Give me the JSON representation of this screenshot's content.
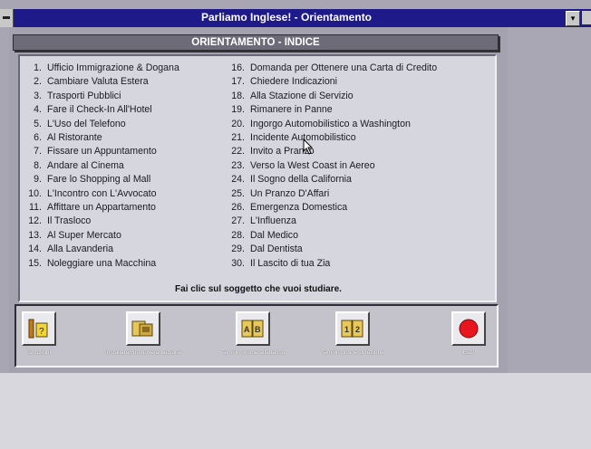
{
  "window": {
    "title": "Parliamo Inglese! - Orientamento",
    "minimize_glyph": "▾"
  },
  "header": {
    "title": "ORIENTAMENTO - INDICE"
  },
  "topics_left": [
    {
      "num": "1.",
      "label": "Ufficio Immigrazione & Dogana"
    },
    {
      "num": "2.",
      "label": "Cambiare Valuta Estera"
    },
    {
      "num": "3.",
      "label": "Trasporti Pubblici"
    },
    {
      "num": "4.",
      "label": "Fare il Check-In All'Hotel"
    },
    {
      "num": "5.",
      "label": "L'Uso del Telefono"
    },
    {
      "num": "6.",
      "label": "Al Ristorante"
    },
    {
      "num": "7.",
      "label": "Fissare un Appuntamento"
    },
    {
      "num": "8.",
      "label": "Andare al Cinema"
    },
    {
      "num": "9.",
      "label": "Fare lo Shopping al Mall"
    },
    {
      "num": "10.",
      "label": "L'Incontro con L'Avvocato"
    },
    {
      "num": "11.",
      "label": "Affittare un Appartamento"
    },
    {
      "num": "12.",
      "label": "Il Trasloco"
    },
    {
      "num": "13.",
      "label": "Al Super Mercato"
    },
    {
      "num": "14.",
      "label": "Alla Lavanderia"
    },
    {
      "num": "15.",
      "label": "Noleggiare una Macchina"
    }
  ],
  "topics_right": [
    {
      "num": "16.",
      "label": "Domanda per Ottenere una Carta di Credito"
    },
    {
      "num": "17.",
      "label": "Chiedere Indicazioni"
    },
    {
      "num": "18.",
      "label": "Alla Stazione di Servizio"
    },
    {
      "num": "19.",
      "label": "Rimanere in Panne"
    },
    {
      "num": "20.",
      "label": "Ingorgo Automobilistico a Washington"
    },
    {
      "num": "21.",
      "label": "Incidente Automobilistico"
    },
    {
      "num": "22.",
      "label": "Invito a Pranzo"
    },
    {
      "num": "23.",
      "label": "Verso la West Coast in Aereo"
    },
    {
      "num": "24.",
      "label": "Il Sogno della California"
    },
    {
      "num": "25.",
      "label": "Un Pranzo D'Affari"
    },
    {
      "num": "26.",
      "label": "Emergenza Domestica"
    },
    {
      "num": "27.",
      "label": "L'Influenza"
    },
    {
      "num": "28.",
      "label": "Dal Medico"
    },
    {
      "num": "29.",
      "label": "Dal Dentista"
    },
    {
      "num": "30.",
      "label": "Il Lascito di tua Zia"
    }
  ],
  "hint": "Fai clic sul soggetto che vuoi studiare.",
  "toolbar": {
    "intro_label": "Istruzioni",
    "install_label": "Installare/Rimuovere Lezione",
    "alpha_label": "Temi in ordine alfabetico",
    "lesson_order_label": "Temi in ordine di lezione",
    "exit_label": "Esci"
  },
  "colors": {
    "titlebar": "#1e1a8a",
    "panel": "#d6d6de",
    "exit_red": "#e8141e"
  }
}
